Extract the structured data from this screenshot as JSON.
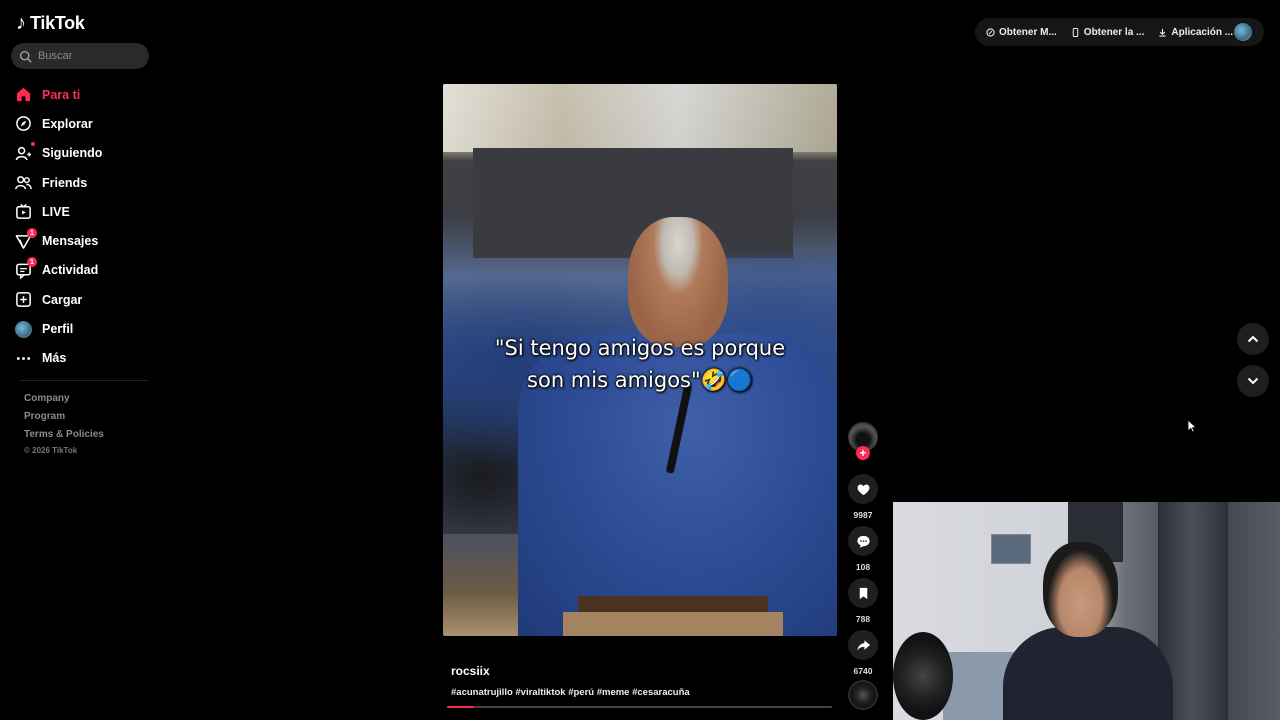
{
  "app": {
    "logo_text": "TikTok"
  },
  "search": {
    "placeholder": "Buscar"
  },
  "sidebar": {
    "items": [
      {
        "label": "Para ti",
        "icon": "home-icon",
        "active": true
      },
      {
        "label": "Explorar",
        "icon": "compass-icon"
      },
      {
        "label": "Siguiendo",
        "icon": "user-follow-icon"
      },
      {
        "label": "Friends",
        "icon": "friends-icon"
      },
      {
        "label": "LIVE",
        "icon": "live-icon"
      },
      {
        "label": "Mensajes",
        "icon": "messages-icon",
        "badge": "1"
      },
      {
        "label": "Actividad",
        "icon": "activity-icon",
        "badge": "1"
      },
      {
        "label": "Cargar",
        "icon": "upload-icon"
      },
      {
        "label": "Perfil",
        "icon": "avatar"
      },
      {
        "label": "Más",
        "icon": "more-icon"
      }
    ],
    "footer": {
      "company": "Company",
      "program": "Program",
      "terms": "Terms & Policies",
      "copyright": "© 2026 TikTok"
    }
  },
  "topbar": {
    "btn1": "Obtener M...",
    "btn2": "Obtener la ...",
    "btn3": "Aplicación ..."
  },
  "video": {
    "caption_line1": "\"Si tengo amigos es porque",
    "caption_line2": "son mis amigos\"🤣🔵",
    "username": "rocsiix",
    "hashtags": "#acunatrujillo #viraltiktok #perú #meme #cesaracuña",
    "progress_fraction": 0.07
  },
  "actions": {
    "likes": "9987",
    "comments": "108",
    "bookmarks": "788",
    "shares": "6740"
  },
  "colors": {
    "accent": "#fe2c55",
    "bg": "#000000"
  }
}
